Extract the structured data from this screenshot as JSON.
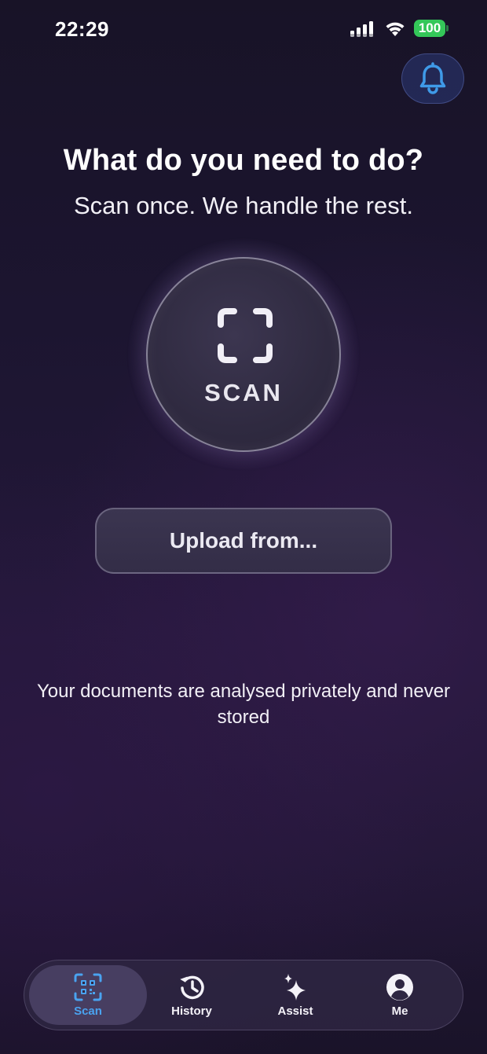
{
  "status_bar": {
    "time": "22:29",
    "battery": "100"
  },
  "header": {
    "bell_icon": "bell-icon"
  },
  "main": {
    "title": "What do you need to do?",
    "subtitle": "Scan once. We handle the rest.",
    "scan_label": "SCAN",
    "upload_label": "Upload from...",
    "privacy_note": "Your documents are analysed privately and never stored"
  },
  "tab_bar": {
    "tabs": [
      {
        "label": "Scan",
        "icon": "qr-scan-icon",
        "active": true
      },
      {
        "label": "History",
        "icon": "history-icon",
        "active": false
      },
      {
        "label": "Assist",
        "icon": "sparkles-icon",
        "active": false
      },
      {
        "label": "Me",
        "icon": "profile-icon",
        "active": false
      }
    ]
  },
  "colors": {
    "accent_blue": "#4aa3f0",
    "battery_green": "#34c759",
    "background": "#1c1530"
  }
}
